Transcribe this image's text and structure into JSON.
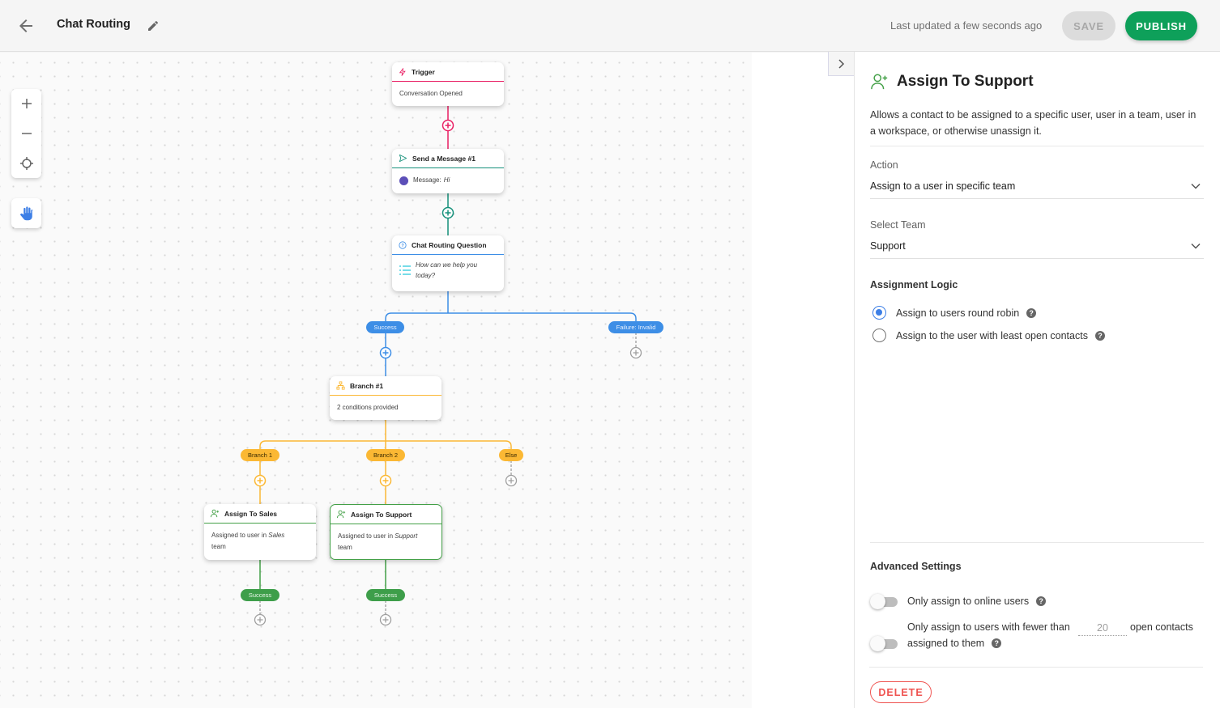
{
  "header": {
    "title": "Chat Routing",
    "last_updated": "Last updated a few seconds ago",
    "save_label": "SAVE",
    "publish_label": "PUBLISH",
    "icons": {
      "back": "arrow-left-icon",
      "edit": "pencil-icon"
    }
  },
  "canvas": {
    "tools": [
      "zoom-in",
      "zoom-out",
      "recenter",
      "pan-hand"
    ],
    "colors": {
      "trigger": "#e91e63",
      "message": "#15907a",
      "question": "#3d8ee6",
      "branch": "#fbb834",
      "assign": "#43a047",
      "empty": "#9e9e9e"
    },
    "nodes": {
      "trigger": {
        "title": "Trigger",
        "body": "Conversation Opened"
      },
      "message": {
        "title": "Send a Message #1",
        "body_label": "Message:",
        "body_value": "Hi"
      },
      "question": {
        "title": "Chat Routing Question",
        "body": "How can we help you today?"
      },
      "branch": {
        "title": "Branch #1",
        "body": "2 conditions provided"
      },
      "assign_sales": {
        "title": "Assign To Sales",
        "body_prefix": "Assigned to user in",
        "team": "Sales",
        "body_suffix": "team"
      },
      "assign_support": {
        "title": "Assign To Support",
        "body_prefix": "Assigned to user in",
        "team": "Support",
        "body_suffix": "team"
      }
    },
    "outcomes": {
      "question_success": "Success",
      "question_failure": "Failure: Invalid",
      "branch_1": "Branch 1",
      "branch_2": "Branch 2",
      "branch_else": "Else",
      "sales_success": "Success",
      "support_success": "Success"
    }
  },
  "panel": {
    "title": "Assign To Support",
    "description": "Allows a contact to be assigned to a specific user, user in a team, user in a workspace, or otherwise unassign it.",
    "action": {
      "label": "Action",
      "value": "Assign to a user in specific team"
    },
    "team": {
      "label": "Select Team",
      "value": "Support"
    },
    "assignment_logic": {
      "title": "Assignment Logic",
      "options": [
        {
          "label": "Assign to users round robin",
          "checked": true
        },
        {
          "label": "Assign to the user with least open contacts",
          "checked": false
        }
      ]
    },
    "advanced": {
      "title": "Advanced Settings",
      "online_only": {
        "label": "Only assign to online users",
        "enabled": false
      },
      "max_open": {
        "label_prefix": "Only assign to users with fewer than",
        "value": "20",
        "label_suffix": "open contacts",
        "label_line2": "assigned to them",
        "enabled": false
      }
    },
    "delete_label": "DELETE"
  }
}
